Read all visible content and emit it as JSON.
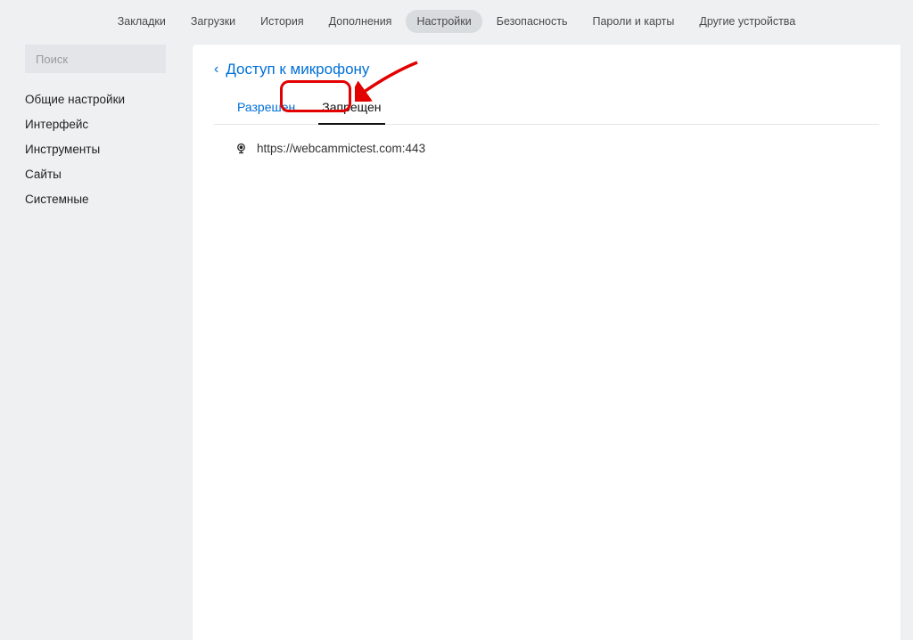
{
  "topnav": {
    "items": [
      {
        "label": "Закладки"
      },
      {
        "label": "Загрузки"
      },
      {
        "label": "История"
      },
      {
        "label": "Дополнения"
      },
      {
        "label": "Настройки"
      },
      {
        "label": "Безопасность"
      },
      {
        "label": "Пароли и карты"
      },
      {
        "label": "Другие устройства"
      }
    ]
  },
  "sidebar": {
    "search_placeholder": "Поиск",
    "items": [
      {
        "label": "Общие настройки"
      },
      {
        "label": "Интерфейс"
      },
      {
        "label": "Инструменты"
      },
      {
        "label": "Сайты"
      },
      {
        "label": "Системные"
      }
    ]
  },
  "main": {
    "back_icon": "‹",
    "title": "Доступ к микрофону",
    "tabs": {
      "allowed": "Разрешен",
      "denied": "Запрещен"
    },
    "sites": [
      {
        "url": "https://webcammictest.com:443"
      }
    ]
  }
}
